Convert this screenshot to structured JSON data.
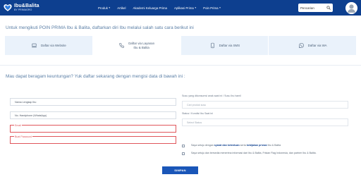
{
  "header": {
    "logo_main": "Ibu&Balita",
    "logo_sub": "BY PRIMAGRO",
    "nav": [
      {
        "label": "Produk",
        "has_dropdown": true
      },
      {
        "label": "Artikel",
        "has_dropdown": false
      },
      {
        "label": "Akademi Keluarga Prima",
        "has_dropdown": false
      },
      {
        "label": "Aplikasi Prima",
        "has_dropdown": true
      },
      {
        "label": "Poin Prima",
        "has_dropdown": true
      }
    ],
    "search_label": "Pencarian",
    "colors": {
      "bar": "#0d3f8f"
    }
  },
  "intro_text": "Untuk mengikuti POIN PRIMA Ibu & Balita, daftarkan diri Ibu melalui salah satu cara berikut ini",
  "tabs": [
    {
      "label": "Daftar via Website",
      "icon": "laptop-icon",
      "active": false
    },
    {
      "label": "Daftar via Layanan\nIbu & Balita",
      "icon": "phone-icon",
      "active": true
    },
    {
      "label": "Daftar via SMS",
      "icon": "mobile-icon",
      "active": false
    },
    {
      "label": "Daftar via WA",
      "icon": "whatsapp-icon",
      "active": false
    }
  ],
  "benefit_text": "Mau dapat beragam keuntungan? Yuk daftar sekarang dengan mengisi data di bawah ini :",
  "form": {
    "left_fields": [
      {
        "label": "Nama Lengkap Ibu",
        "error": false
      },
      {
        "label": "No. Handphone (WhatsApp)",
        "error": false
      },
      {
        "label": "Email",
        "error": true
      },
      {
        "label": "Buat Password",
        "error": true
      }
    ],
    "product_label": "Susu yang dikonsumsi anak saat ini / Susu Ibu hamil",
    "product_placeholder": "Cari produk susu",
    "status_label": "Status / Kondisi Ibu Saat ini",
    "status_placeholder": "Select Status",
    "terms": {
      "prefix": "Saya setuju dengan ",
      "link1": "syarat dan ketentuan",
      "middle": " serta ",
      "link2": "kebijakan privasi",
      "suffix": " Ibu & Balita"
    },
    "consent_text": "Saya setuju dan bersedia menerima informasi dari Ibu & Balita, Frisian Flag Indonesia, dan partner Ibu & Balita.",
    "submit_label": "SIMPAN"
  }
}
